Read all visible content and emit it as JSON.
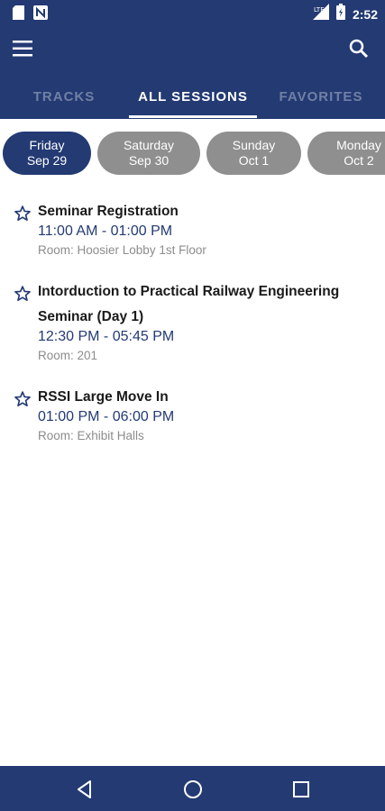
{
  "status_bar": {
    "time": "2:52"
  },
  "tabs": [
    {
      "label": "TRACKS",
      "active": false
    },
    {
      "label": "ALL SESSIONS",
      "active": true
    },
    {
      "label": "FAVORITES",
      "active": false
    }
  ],
  "days": [
    {
      "weekday": "Friday",
      "date": "Sep 29",
      "active": true
    },
    {
      "weekday": "Saturday",
      "date": "Sep 30",
      "active": false
    },
    {
      "weekday": "Sunday",
      "date": "Oct 1",
      "active": false
    },
    {
      "weekday": "Monday",
      "date": "Oct 2",
      "active": false
    }
  ],
  "sessions": [
    {
      "title": "Seminar Registration",
      "time": "11:00 AM - 01:00 PM",
      "room": "Room: Hoosier Lobby 1st Floor",
      "favorite": false
    },
    {
      "title": "Intorduction to Practical Railway Engineering Seminar (Day 1)",
      "time": "12:30 PM - 05:45 PM",
      "room": "Room: 201",
      "favorite": false
    },
    {
      "title": "RSSI Large Move In",
      "time": "01:00 PM - 06:00 PM",
      "room": "Room: Exhibit Halls",
      "favorite": false
    }
  ],
  "icons": {
    "status_left": [
      "sd-card-icon",
      "n-notification-icon"
    ],
    "status_right": [
      "signal-icon",
      "battery-icon"
    ],
    "app_bar": [
      "menu-icon",
      "search-icon"
    ],
    "session": "star-outline-icon",
    "nav": [
      "back-icon",
      "home-icon",
      "recents-icon"
    ]
  },
  "colors": {
    "primary": "#233a73",
    "chip_inactive": "#8f8f8f",
    "muted_text": "#8c8c8c"
  }
}
